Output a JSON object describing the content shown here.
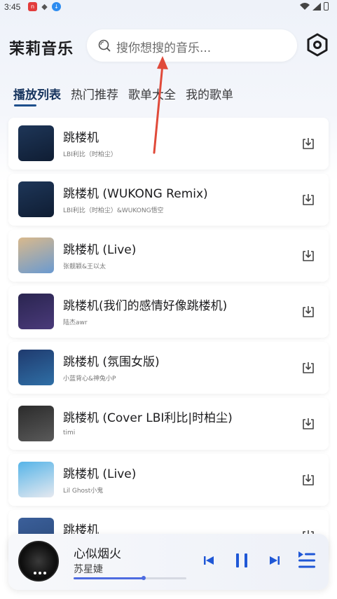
{
  "status": {
    "time": "3:45"
  },
  "app": {
    "title": "茉莉音乐"
  },
  "search": {
    "placeholder": "搜你想搜的音乐..."
  },
  "tabs": [
    {
      "label": "播放列表",
      "active": true
    },
    {
      "label": "热门推荐",
      "active": false
    },
    {
      "label": "歌单大全",
      "active": false
    },
    {
      "label": "我的歌单",
      "active": false
    }
  ],
  "songs": [
    {
      "title": "跳楼机",
      "artist": "LBI利比（时柏尘）",
      "cover_colors": [
        "#1e3658",
        "#0f1d33"
      ]
    },
    {
      "title": "跳楼机 (WUKONG Remix)",
      "artist": "LBI利比（时柏尘）&WUKONG悟空",
      "cover_colors": [
        "#1e3658",
        "#0f1d33"
      ]
    },
    {
      "title": "跳楼机 (Live)",
      "artist": "张靓颖&王以太",
      "cover_colors": [
        "#d9b98c",
        "#6a9ad0"
      ]
    },
    {
      "title": "跳楼机(我们的感情好像跳楼机)",
      "artist": "陆杰awr",
      "cover_colors": [
        "#2a2550",
        "#4a3a7a"
      ]
    },
    {
      "title": "跳楼机 (氛围女版)",
      "artist": "小蓝背心&神兔小P",
      "cover_colors": [
        "#1f3a6e",
        "#2f6fa6"
      ]
    },
    {
      "title": "跳楼机 (Cover LBI利比|时柏尘)",
      "artist": "timi",
      "cover_colors": [
        "#2b2b2b",
        "#5a5a5a"
      ]
    },
    {
      "title": "跳楼机 (Live)",
      "artist": "Lil Ghost小鬼",
      "cover_colors": [
        "#56b4e8",
        "#e6e9f0"
      ]
    },
    {
      "title": "跳楼机",
      "artist": "",
      "cover_colors": [
        "#3b5f9a",
        "#2a4a7a"
      ]
    }
  ],
  "player": {
    "title": "心似烟火",
    "artist": "苏星婕",
    "progress": 0.62
  },
  "colors": {
    "accent": "#1e4f8c",
    "annotation_arrow": "#e04a3a"
  }
}
